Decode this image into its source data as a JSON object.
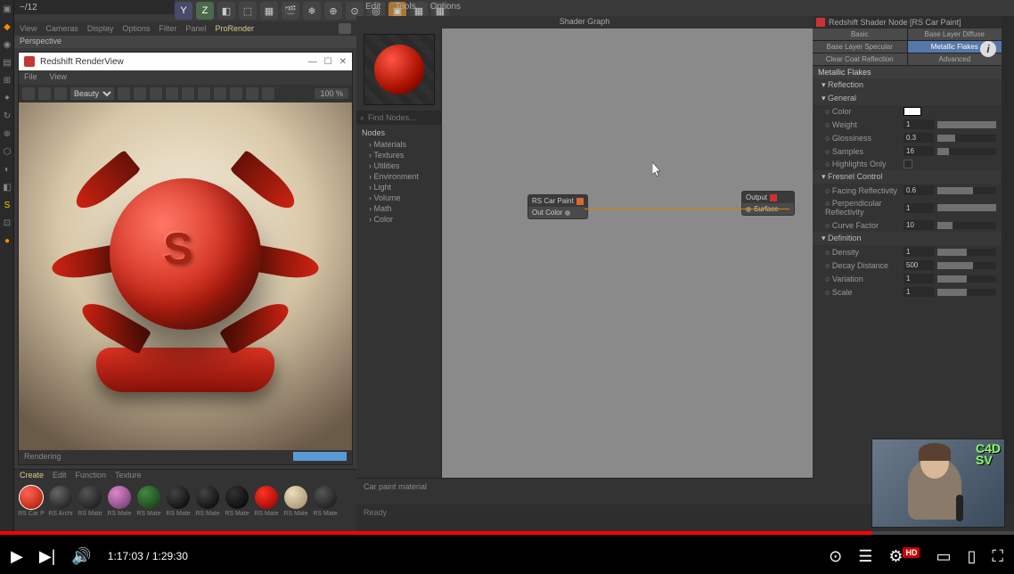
{
  "title": "~/12",
  "top_shelf": [
    "Y",
    "Z",
    "◧",
    "⬚",
    "▦",
    "🎬",
    "❄",
    "⊕",
    "⊙",
    "◎",
    "▣",
    "▦",
    "▦"
  ],
  "top_menus": [
    "Edit",
    "Tools",
    "Options"
  ],
  "viewport": {
    "menus": [
      "View",
      "Cameras",
      "Display",
      "Options",
      "Filter",
      "Panel",
      "ProRender"
    ],
    "active_menu": "ProRender",
    "label": "Perspective"
  },
  "render_window": {
    "title": "Redshift RenderView",
    "menus": [
      "File",
      "View"
    ],
    "mode": "Beauty",
    "zoom": "100 %",
    "status": "Rendering"
  },
  "materials": {
    "tabs": [
      "Create",
      "Edit",
      "Function",
      "Texture"
    ],
    "active_tab": "Create",
    "swatches": [
      {
        "label": "RS Car P",
        "color": "radial-gradient(circle at 35% 30%, #ff6655, #aa1100)",
        "sel": true
      },
      {
        "label": "RS Archi",
        "color": "radial-gradient(circle at 35% 30%, #666, #111)"
      },
      {
        "label": "RS Mate",
        "color": "radial-gradient(circle at 35% 30%, #555, #111)"
      },
      {
        "label": "RS Mate",
        "color": "radial-gradient(circle at 35% 30%, #dd88cc, #663366)"
      },
      {
        "label": "RS Mate",
        "color": "radial-gradient(circle at 35% 30%, #448844, #113311)"
      },
      {
        "label": "RS Mate",
        "color": "radial-gradient(circle at 35% 30%, #444, #000)"
      },
      {
        "label": "RS Mate",
        "color": "radial-gradient(circle at 35% 30%, #444, #000)"
      },
      {
        "label": "RS Mate",
        "color": "radial-gradient(circle at 35% 30%, #333, #000)"
      },
      {
        "label": "RS Mate",
        "color": "radial-gradient(circle at 35% 30%, #ff3322, #880000)"
      },
      {
        "label": "RS Mate",
        "color": "radial-gradient(circle at 35% 30%, #eeddbb, #998866)"
      },
      {
        "label": "RS Mate",
        "color": "radial-gradient(circle at 35% 30%, #555, #111)"
      }
    ]
  },
  "shader": {
    "title": "Shader Graph",
    "find_placeholder": "Find Nodes...",
    "tree_header": "Nodes",
    "tree": [
      "Materials",
      "Textures",
      "Utilities",
      "Environment",
      "Light",
      "Volume",
      "Math",
      "Color"
    ],
    "node1": {
      "title": "RS Car Paint",
      "out": "Out Color"
    },
    "node2": {
      "title": "Output",
      "in": "Surface"
    },
    "bottom": "Car paint material"
  },
  "attributes": {
    "title": "Redshift Shader Node [RS Car Paint]",
    "tabs": [
      "Basic",
      "Base Layer Diffuse",
      "Base Layer Specular",
      "Metallic Flakes",
      "Clear Coat Reflection",
      "Advanced"
    ],
    "active_tab": "Metallic Flakes",
    "section": "Metallic Flakes",
    "groups": [
      {
        "name": "Reflection"
      },
      {
        "name": "General",
        "rows": [
          {
            "label": "Color",
            "type": "color",
            "value": "#ffffff"
          },
          {
            "label": "Weight",
            "type": "num",
            "value": "1",
            "fill": 100
          },
          {
            "label": "Glossiness",
            "type": "num",
            "value": "0.3",
            "fill": 30
          },
          {
            "label": "Samples",
            "type": "num",
            "value": "16",
            "fill": 20
          },
          {
            "label": "Highlights Only",
            "type": "check"
          }
        ]
      },
      {
        "name": "Fresnel Control",
        "rows": [
          {
            "label": "Facing Reflectivity",
            "type": "num",
            "value": "0.6",
            "fill": 60
          },
          {
            "label": "Perpendicular Reflectivity",
            "type": "num",
            "value": "1",
            "fill": 100
          },
          {
            "label": "Curve Factor",
            "type": "num",
            "value": "10",
            "fill": 25
          }
        ]
      },
      {
        "name": "Definition",
        "rows": [
          {
            "label": "Density",
            "type": "num",
            "value": "1",
            "fill": 50
          },
          {
            "label": "Decay Distance",
            "type": "num",
            "value": "500",
            "fill": 60
          },
          {
            "label": "Variation",
            "type": "num",
            "value": "1",
            "fill": 50
          },
          {
            "label": "Scale",
            "type": "num",
            "value": "1",
            "fill": 50
          }
        ]
      }
    ]
  },
  "status": "Ready",
  "bottom_left_text": "",
  "video": {
    "current": "1:17:03",
    "total": "1:29:30",
    "progress_pct": 86,
    "badge": "HD"
  },
  "webcam_badge": "C4D\nSV"
}
